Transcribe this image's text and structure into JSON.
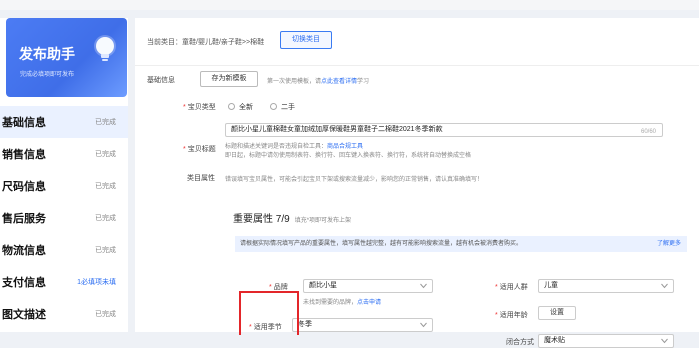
{
  "helper": {
    "title": "发布助手",
    "subtitle": "完成必填项即可发布"
  },
  "nav": [
    {
      "label": "基础信息",
      "status": "已完成",
      "active": true
    },
    {
      "label": "销售信息",
      "status": "已完成"
    },
    {
      "label": "尺码信息",
      "status": "已完成"
    },
    {
      "label": "售后服务",
      "status": "已完成"
    },
    {
      "label": "物流信息",
      "status": "已完成"
    },
    {
      "label": "支付信息",
      "status": "1必填项未填",
      "warn": true
    },
    {
      "label": "图文描述",
      "status": "已完成"
    }
  ],
  "category": {
    "text": "当前类目：童鞋/婴儿鞋/亲子鞋>>棉鞋",
    "switch_label": "切换类目"
  },
  "basic": {
    "section_label": "基础信息",
    "save_template_label": "存为新模板",
    "template_hint": "第一次使用模板，请",
    "template_link": "点此查看详情",
    "template_hint_tail": "学习"
  },
  "type_row": {
    "label": "宝贝类型",
    "options": [
      "全新",
      "二手"
    ]
  },
  "title_row": {
    "label": "宝贝标题",
    "value": "颜比小星儿童棉鞋女童加绒加厚保暖鞋男童鞋子二棉鞋2021冬季新款",
    "counter": "60/60",
    "hint1": "标题和描述关键词是否违规自检工具：",
    "hint1_link": "商品合规工具",
    "hint2": "即日起，标题中请勿使用制表符、换行符、回车键入换表符、换行符，系统将自动替换成空格"
  },
  "attr_row": {
    "label": "类目属性",
    "warning": "错误填写宝贝属性，可能会引起宝贝下架或搜索流量减少，影响您的正常销售，请认真准确填写！"
  },
  "important": {
    "title": "重要属性",
    "count": "7/9",
    "sub": "填充*项即可发布上架",
    "tip": "请根据实际情况填写产品的重要属性，填写属性越完整，越有可能影响搜索流量，越有机会被消费者购买。",
    "tip_link": "了解更多"
  },
  "fields": {
    "brand_label": "品牌",
    "brand_value": "颜比小星",
    "brand_hint": "未找到需要的品牌，",
    "brand_hint_link": "点击申请",
    "season_label": "适用季节",
    "season_value": "冬季",
    "people_label": "适用人群",
    "people_value": "儿童",
    "age_label": "适用年龄",
    "age_btn": "设置",
    "closure_label": "闭合方式",
    "closure_value": "魔术贴"
  }
}
